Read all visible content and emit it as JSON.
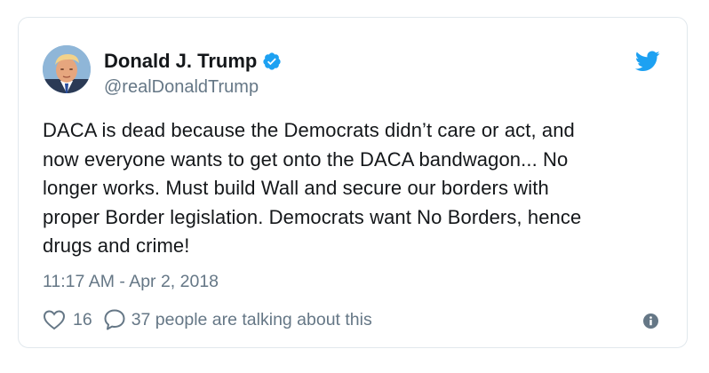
{
  "tweet": {
    "display_name": "Donald J. Trump",
    "handle": "@realDonaldTrump",
    "text": "DACA is dead because the Democrats didn’t care or act, and\nnow everyone wants to get onto the DACA bandwagon... No\nlonger works. Must build Wall and secure our borders with\nproper Border legislation. Democrats want No Borders, hence\ndrugs and crime!",
    "timestamp": "11:17 AM - Apr 2, 2018",
    "like_count": "16",
    "talking_text": "37 people are talking about this"
  },
  "icons": {
    "verified": "verified-badge-icon",
    "brand": "twitter-bird-icon",
    "like": "heart-icon",
    "reply": "speech-bubble-icon",
    "info": "info-icon"
  },
  "colors": {
    "brand_blue": "#1da1f2",
    "text_primary": "#14171a",
    "text_secondary": "#657786",
    "border": "#e1e8ed"
  }
}
